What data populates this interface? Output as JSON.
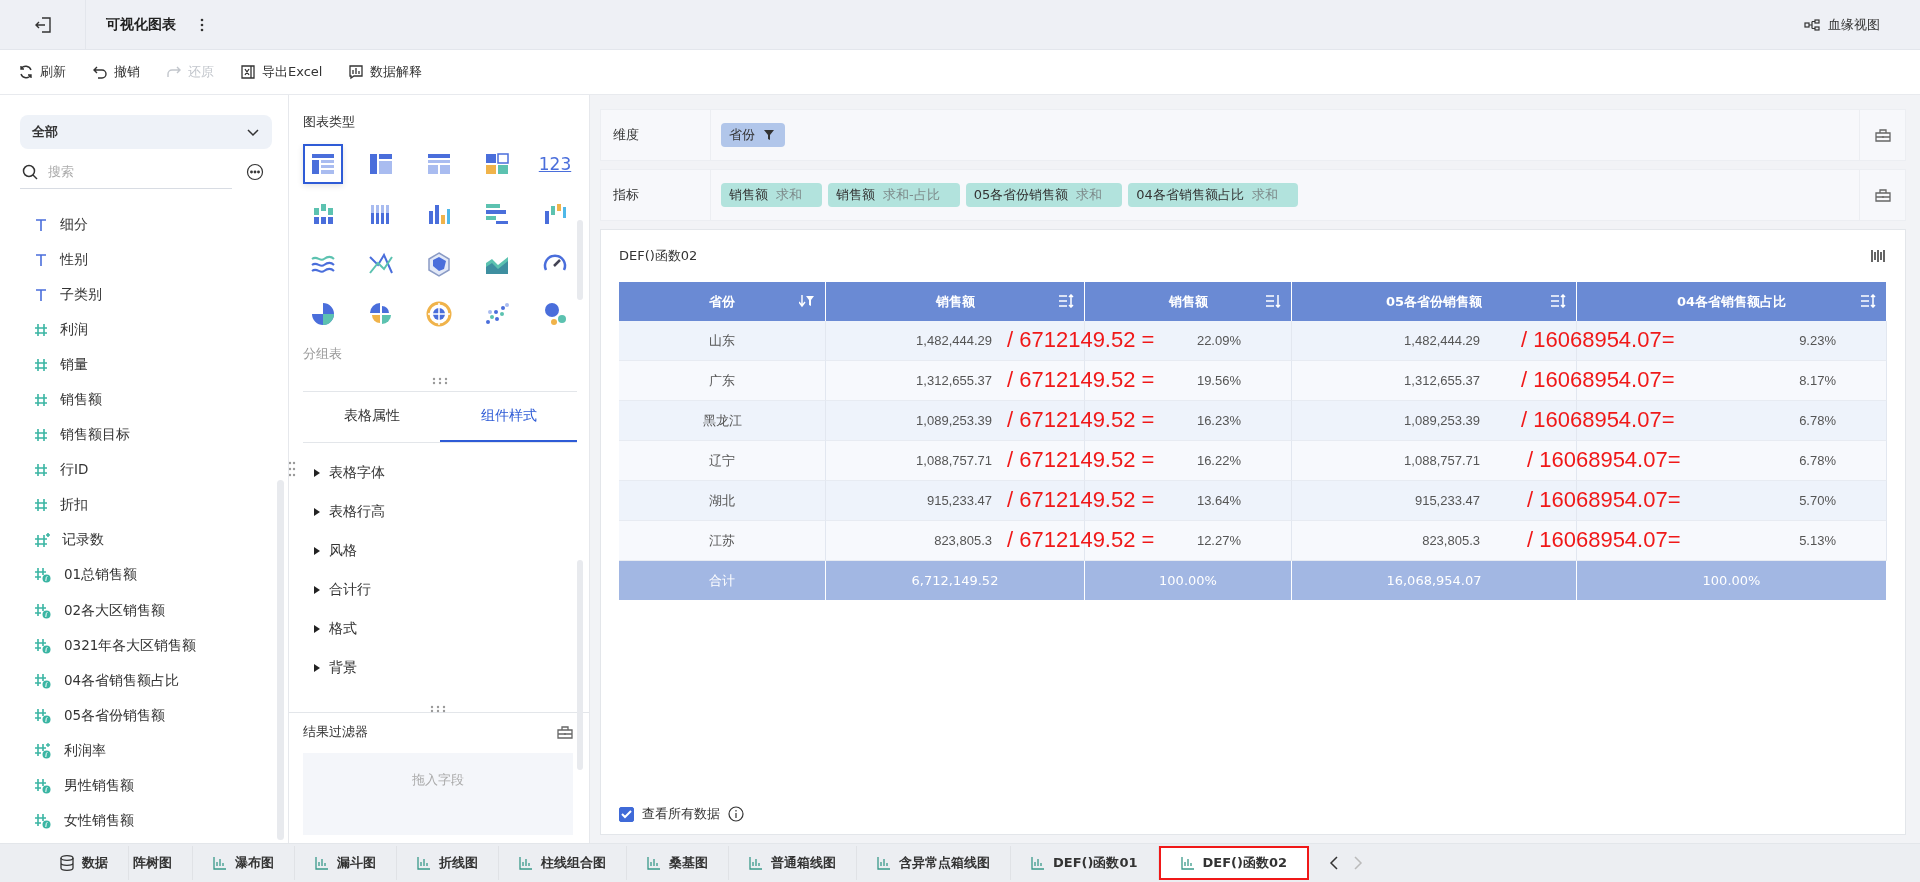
{
  "header": {
    "title": "可视化图表",
    "right_link": "血缘视图"
  },
  "toolbar": [
    {
      "kind": "refresh",
      "label": "刷新",
      "disabled": false
    },
    {
      "kind": "undo",
      "label": "撤销",
      "disabled": false
    },
    {
      "kind": "redo",
      "label": "还原",
      "disabled": true
    },
    {
      "kind": "excel",
      "label": "导出Excel",
      "disabled": false
    },
    {
      "kind": "explain",
      "label": "数据解释",
      "disabled": false
    }
  ],
  "field_panel": {
    "scope": "全部",
    "search": {
      "placeholder": "搜索"
    },
    "fields": [
      {
        "kind": "dimension",
        "label": "细分"
      },
      {
        "kind": "dimension",
        "label": "性别"
      },
      {
        "kind": "dimension",
        "label": "子类别"
      },
      {
        "kind": "measure",
        "label": "利润"
      },
      {
        "kind": "measure",
        "label": "销量"
      },
      {
        "kind": "measure",
        "label": "销售额"
      },
      {
        "kind": "measure",
        "label": "销售额目标"
      },
      {
        "kind": "measure",
        "label": "行ID"
      },
      {
        "kind": "measure",
        "label": "折扣"
      },
      {
        "kind": "count",
        "label": "记录数"
      },
      {
        "kind": "calc",
        "label": "01总销售额"
      },
      {
        "kind": "calc",
        "label": "02各大区销售额"
      },
      {
        "kind": "calc",
        "label": "0321年各大区销售额"
      },
      {
        "kind": "calc",
        "label": "04各省销售额占比"
      },
      {
        "kind": "calc",
        "label": "05各省份销售额"
      },
      {
        "kind": "calc-count",
        "label": "利润率"
      },
      {
        "kind": "calc",
        "label": "男性销售额"
      },
      {
        "kind": "calc",
        "label": "女性销售额"
      }
    ]
  },
  "chart_panel": {
    "title": "图表类型",
    "chart_types": [
      {
        "kind": "table",
        "selected": true
      },
      {
        "kind": "cross",
        "selected": false
      },
      {
        "kind": "detail",
        "selected": false
      },
      {
        "kind": "kpi",
        "selected": false
      },
      {
        "kind": "number",
        "label": "123",
        "selected": false
      },
      {
        "kind": "stacked",
        "selected": false
      },
      {
        "kind": "grouped",
        "selected": false
      },
      {
        "kind": "column",
        "selected": false
      },
      {
        "kind": "hbar",
        "selected": false
      },
      {
        "kind": "waterfall",
        "selected": false
      },
      {
        "kind": "stream",
        "selected": false
      },
      {
        "kind": "line",
        "selected": false
      },
      {
        "kind": "radar",
        "selected": false
      },
      {
        "kind": "area",
        "selected": false
      },
      {
        "kind": "gauge",
        "selected": false
      },
      {
        "kind": "pie",
        "selected": false
      },
      {
        "kind": "rose",
        "selected": false
      },
      {
        "kind": "sunburst",
        "selected": false
      },
      {
        "kind": "scatter",
        "selected": false
      },
      {
        "kind": "bubble",
        "selected": false
      }
    ],
    "chart_name": "分组表",
    "tabs": [
      {
        "label": "表格属性",
        "selected": false
      },
      {
        "label": "组件样式",
        "selected": true
      }
    ],
    "style_items": [
      "表格字体",
      "表格行高",
      "风格",
      "合计行",
      "格式",
      "背景"
    ],
    "filter": {
      "title": "结果过滤器",
      "placeholder": "拖入字段"
    }
  },
  "dimension_row": {
    "label": "维度",
    "chips": [
      {
        "name": "省份"
      }
    ]
  },
  "metric_row": {
    "label": "指标",
    "chips": [
      {
        "name": "销售额",
        "agg": "求和"
      },
      {
        "name": "销售额",
        "agg": "求和-占比"
      },
      {
        "name": "05各省份销售额",
        "agg": "求和"
      },
      {
        "name": "04各省销售额占比",
        "agg": "求和"
      }
    ]
  },
  "chart": {
    "title": "DEF()函数02",
    "columns": [
      {
        "label": "省份",
        "kind": "filter"
      },
      {
        "label": "销售额",
        "kind": "both"
      },
      {
        "label": "销售额",
        "kind": "down"
      },
      {
        "label": "05各省份销售额",
        "kind": "both"
      },
      {
        "label": "04各省销售额占比",
        "kind": "both"
      }
    ],
    "rows": [
      {
        "cells": [
          "山东",
          "1,482,444.29",
          "22.09%",
          "1,482,444.29",
          "9.23%"
        ],
        "notes": [
          "/ 6712149.52 =",
          "/ 16068954.07="
        ]
      },
      {
        "cells": [
          "广东",
          "1,312,655.37",
          "19.56%",
          "1,312,655.37",
          "8.17%"
        ],
        "notes": [
          "/ 6712149.52 =",
          "/ 16068954.07="
        ]
      },
      {
        "cells": [
          "黑龙江",
          "1,089,253.39",
          "16.23%",
          "1,089,253.39",
          "6.78%"
        ],
        "notes": [
          "/ 6712149.52 =",
          "/ 16068954.07="
        ]
      },
      {
        "cells": [
          "辽宁",
          "1,088,757.71",
          "16.22%",
          "1,088,757.71",
          "6.78%"
        ],
        "notes": [
          "/ 6712149.52 =",
          "/ 16068954.07="
        ]
      },
      {
        "cells": [
          "湖北",
          "915,233.47",
          "13.64%",
          "915,233.47",
          "5.70%"
        ],
        "notes": [
          "/ 6712149.52 =",
          "/ 16068954.07="
        ]
      },
      {
        "cells": [
          "江苏",
          "823,805.3",
          "12.27%",
          "823,805.3",
          "5.13%"
        ],
        "notes": [
          "/ 6712149.52 =",
          "/ 16068954.07="
        ]
      }
    ],
    "total": [
      "合计",
      "6,712,149.52",
      "100.00%",
      "16,068,954.07",
      "100.00%"
    ],
    "show_all": {
      "label": "查看所有数据",
      "checked": true
    }
  },
  "sheet_tabs": [
    {
      "kind": "data",
      "label": "数据",
      "selected": false,
      "highlighted": false
    },
    {
      "kind": "partial",
      "label": "阵树图",
      "selected": false,
      "highlighted": false
    },
    {
      "kind": "sheet",
      "label": "瀑布图",
      "selected": false,
      "highlighted": false
    },
    {
      "kind": "sheet",
      "label": "漏斗图",
      "selected": false,
      "highlighted": false
    },
    {
      "kind": "sheet",
      "label": "折线图",
      "selected": false,
      "highlighted": false
    },
    {
      "kind": "sheet",
      "label": "柱线组合图",
      "selected": false,
      "highlighted": false
    },
    {
      "kind": "sheet",
      "label": "桑基图",
      "selected": false,
      "highlighted": false
    },
    {
      "kind": "sheet",
      "label": "普通箱线图",
      "selected": false,
      "highlighted": false
    },
    {
      "kind": "sheet",
      "label": "含异常点箱线图",
      "selected": false,
      "highlighted": false
    },
    {
      "kind": "sheet",
      "label": "DEF()函数01",
      "selected": false,
      "highlighted": false
    },
    {
      "kind": "sheet",
      "label": "DEF()函数02",
      "selected": true,
      "highlighted": true
    }
  ]
}
